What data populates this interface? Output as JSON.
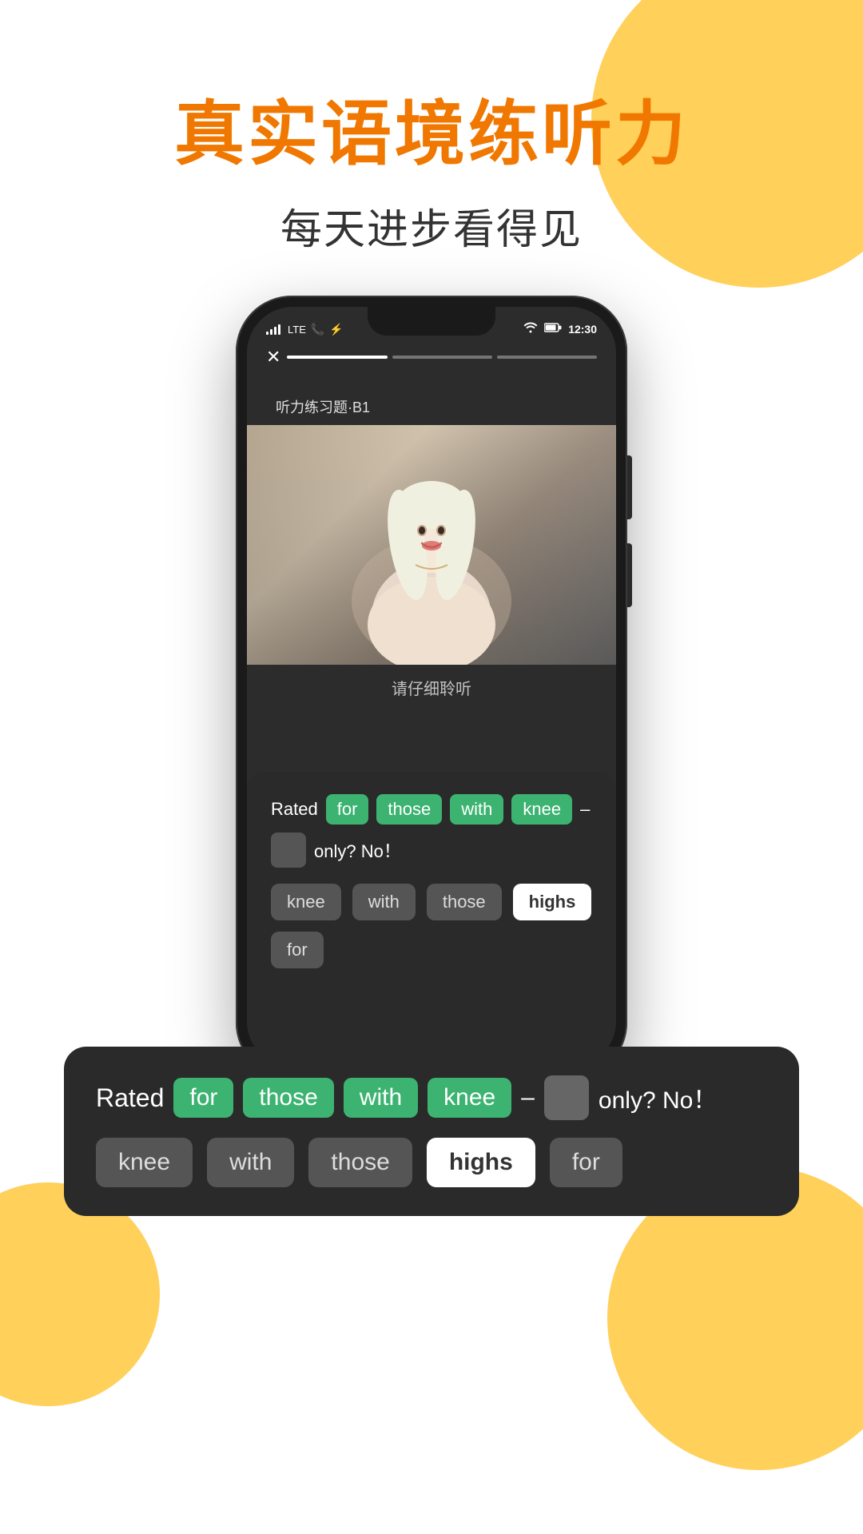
{
  "page": {
    "background": "#ffffff"
  },
  "header": {
    "main_title": "真实语境练听力",
    "sub_title": "每天进步看得见"
  },
  "phone": {
    "status_bar": {
      "signal": "...l LTE",
      "time": "12:30",
      "icons": [
        "phone-icon",
        "bluetooth-icon",
        "wifi-icon",
        "battery-icon"
      ]
    },
    "progress": {
      "bars": 3,
      "active_index": 0
    },
    "lesson_label": "听力练习题·B1",
    "listen_text": "请仔细聆听",
    "sentence": {
      "prefix": "Rated",
      "words": [
        "for",
        "those",
        "with",
        "knee"
      ],
      "dash": "–",
      "blank": true,
      "suffix": "only?  No！"
    },
    "choices": [
      "knee",
      "with",
      "those",
      "highs",
      "for"
    ],
    "selected_choice": "highs"
  },
  "bottom_panel": {
    "sentence": {
      "prefix": "Rated",
      "words": [
        "for",
        "those",
        "with",
        "knee"
      ],
      "dash": "–",
      "blank": true,
      "suffix": "only?  No！"
    },
    "choices": [
      {
        "label": "knee",
        "selected": false
      },
      {
        "label": "with",
        "selected": false
      },
      {
        "label": "those",
        "selected": false
      },
      {
        "label": "highs",
        "selected": true
      },
      {
        "label": "for",
        "selected": false
      }
    ]
  }
}
